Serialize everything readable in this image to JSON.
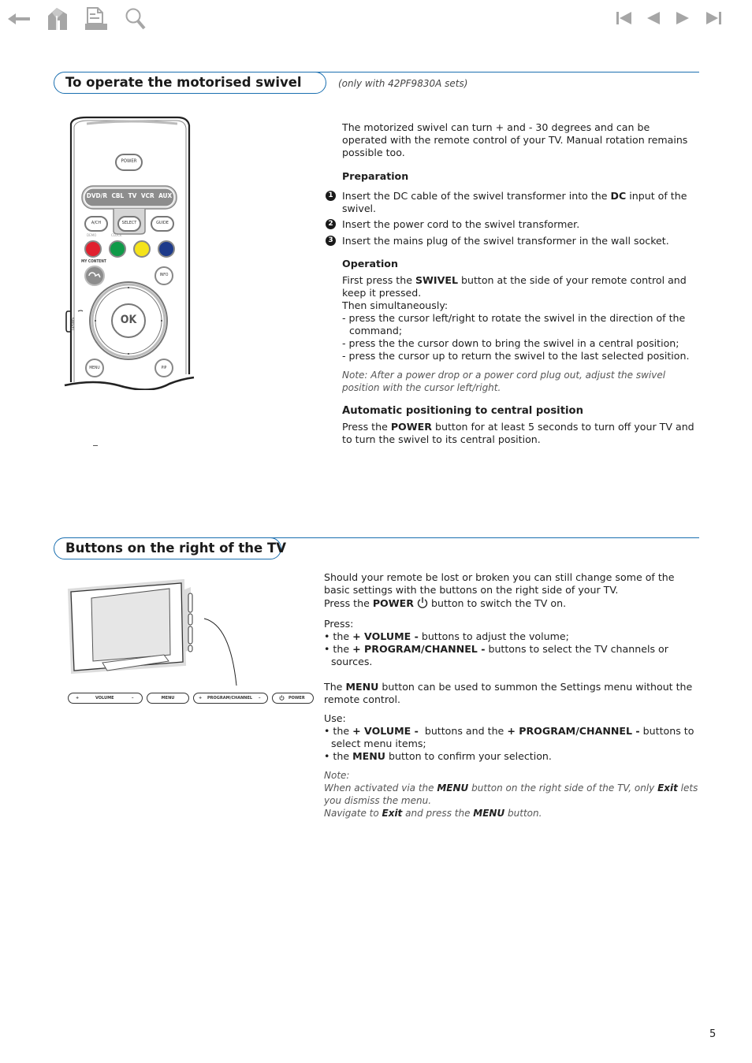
{
  "navigation": {
    "left": [
      {
        "icon": "back-arrow-icon",
        "label": "Back"
      },
      {
        "icon": "home-icon",
        "label": "Home"
      },
      {
        "icon": "print-icon",
        "label": "Print"
      },
      {
        "icon": "search-icon",
        "label": "Search"
      }
    ],
    "right": [
      {
        "icon": "first-page-icon",
        "label": "First page"
      },
      {
        "icon": "previous-page-icon",
        "label": "Previous page"
      },
      {
        "icon": "next-page-icon",
        "label": "Next page"
      },
      {
        "icon": "last-page-icon",
        "label": "Last page"
      }
    ],
    "icon_color": "#a6a6a6"
  },
  "accent_color": "#1a6fb0",
  "section1": {
    "title": "To operate the motorised swivel",
    "subtitle": "(only with 42PF9830A sets)",
    "intro": "The motorized swivel can turn + and - 30 degrees and can be operated with the remote control of your TV. Manual rotation remains possible too.",
    "preparation": {
      "heading": "Preparation",
      "steps": [
        {
          "num": "1",
          "pre": "Insert the DC cable of the swivel transformer into the ",
          "bold": "DC",
          "post": " input of the swivel."
        },
        {
          "num": "2",
          "text": "Insert the power cord to the swivel transformer."
        },
        {
          "num": "3",
          "text": "Insert the mains plug of the swivel transformer in the wall socket."
        }
      ]
    },
    "operation": {
      "heading": "Operation",
      "line1_pre": "First press the ",
      "line1_bold": "SWIVEL",
      "line1_post": " button at the side of your remote control and keep it pressed.",
      "line2": "Then simultaneously:",
      "dashes": [
        "- press the cursor left/right to rotate the swivel in the direction of the command;",
        "- press the the cursor down to bring the swivel in a central position;",
        "- press the cursor up to return the swivel to the last selected position."
      ],
      "note": "Note: After a power drop or a power cord plug out, adjust the swivel position with the cursor left/right."
    },
    "auto": {
      "heading": "Automatic positioning to central position",
      "pre": "Press the ",
      "bold": "POWER",
      "post": " button for at least 5 seconds to turn off your TV and to turn the swivel to its central position."
    },
    "remote": {
      "power": "POWER",
      "sources": [
        "DVD/R",
        "CBL",
        "TV",
        "VCR",
        "AUX"
      ],
      "ach": "A/CH",
      "select": "SELECT",
      "guide": "GUIDE",
      "demo": "DEMO",
      "clock": "CLOCK",
      "color_keys": [
        "#e0202e",
        "#0f9a48",
        "#f5e31a",
        "#1d3a8a"
      ],
      "my_content": "MY CONTENT",
      "info": "INFO",
      "ok": "OK",
      "swivel": "SWIVEL",
      "menu": "MENU",
      "pip": "PIP"
    }
  },
  "section2": {
    "title": "Buttons on the right of the TV",
    "p1_line1": "Should your remote be lost or broken you can still change some of the basic settings with the buttons on the right side of your TV.",
    "p1_power_pre": "Press the ",
    "p1_power_bold": "POWER",
    "p1_power_post": " button to switch the TV on.",
    "press_label": "Press:",
    "press_items": [
      {
        "pre": "• the ",
        "bold": "+ VOLUME -",
        "post": " buttons to adjust the volume;"
      },
      {
        "pre": "• the ",
        "bold": "+ PROGRAM/CHANNEL -",
        "post": " buttons to select the TV channels or sources."
      }
    ],
    "menu_pre": "The ",
    "menu_bold": "MENU",
    "menu_post": " button can be used to summon the Settings menu without the remote control.",
    "use_label": "Use:",
    "use_items": [
      {
        "pre": "• the ",
        "bold": "+ VOLUME -",
        "mid": "  buttons and the ",
        "bold2": "+ PROGRAM/CHANNEL -",
        "post": " buttons to select menu items;"
      },
      {
        "pre": "• the ",
        "bold": "MENU",
        "post": " button to confirm your selection."
      }
    ],
    "note_label": "Note:",
    "note_line1_pre": "When activated via the ",
    "note_line1_bold": "MENU",
    "note_line1_mid": " button on the right side of the TV, only ",
    "note_line1_bold2": "Exit",
    "note_line1_post": " lets you dismiss the menu.",
    "note_line2_pre": "Navigate to ",
    "note_line2_bold": "Exit",
    "note_line2_mid": " and press the ",
    "note_line2_bold2": "MENU",
    "note_line2_post": " button.",
    "tv_buttons": {
      "volume_plus": "+",
      "volume": "VOLUME",
      "volume_minus": "–",
      "menu": "MENU",
      "program_plus": "+",
      "program": "PROGRAM/CHANNEL",
      "program_minus": "–",
      "power": "POWER"
    }
  },
  "page_number": "5"
}
